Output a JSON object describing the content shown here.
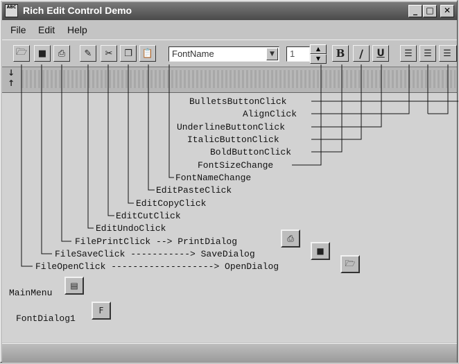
{
  "window": {
    "title": "Rich Edit Control Demo",
    "icon_text": "ABC"
  },
  "title_buttons": {
    "minimize": "_",
    "maximize": "□",
    "close": "✕"
  },
  "menu": {
    "file": "File",
    "edit": "Edit",
    "help": "Help"
  },
  "toolbar": {
    "font_name": "FontName",
    "font_size": "1",
    "bold": "B",
    "italic": "/",
    "underline": "U"
  },
  "annotations": {
    "bullets": "BulletsButtonClick",
    "align": "AlignClick",
    "underline": "UnderlineButtonClick",
    "italic": "ItalicButtonClick",
    "bold": "BoldButtonClick",
    "font_size": "FontSizeChange",
    "font_name": "FontNameChange",
    "paste": "EditPasteClick",
    "copy": "EditCopyClick",
    "cut": "EditCutClick",
    "undo": "EditUndoClick",
    "print": "FilePrintClick --> PrintDialog",
    "save": "FileSaveClick -----------> SaveDialog",
    "open": "FileOpenClick -------------------> OpenDialog"
  },
  "components": {
    "main_menu": "MainMenu",
    "font_dialog": "FontDialog1"
  }
}
